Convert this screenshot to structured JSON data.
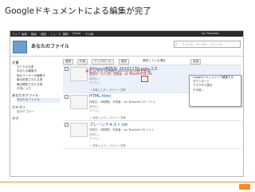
{
  "slide": {
    "title": "Googleドキュメントによる編集が完了"
  },
  "topbar": {
    "links": [
      "ウェブ",
      "画像",
      "動画",
      "地図",
      "ニュース",
      "翻訳",
      "Gmail",
      "その他"
    ],
    "user": "jun Terashita"
  },
  "header": {
    "title": "あなたのファイル",
    "search_placeholder": "ファイル、ユーザー、サイトの"
  },
  "sidebar": {
    "sections": [
      {
        "heading": "文書",
        "items": [
          "すべての文書",
          "あなたの編集中",
          "他のユーザーが編集中",
          "最近変更された文書",
          "最近閲覧された文書",
          "お気に入り"
        ]
      },
      {
        "heading": "あなたのファイル",
        "items": [
          "あなたのファイル"
        ]
      },
      {
        "heading": "カテゴリ",
        "items": [
          "全カテゴリー"
        ]
      },
      {
        "heading": "タグ",
        "items": []
      }
    ]
  },
  "toolbar": {
    "select": "選択",
    "create": "作成",
    "upload": "アップロード",
    "actions": "操作",
    "sort": "名前",
    "filter": "選択している項目"
  },
  "annotation": "チェックインされてバージョンが上がる",
  "files": [
    {
      "name": "Alfresco勉強会_20101130.pptx",
      "version": "2.0",
      "meta": "変更日：ちゃう作、変更者：jun Terashita   187 KB",
      "desc": "説明なし",
      "tags": "タグなし",
      "actions": "☆ お気に入り ▫ コメント 共有"
    },
    {
      "name": "HTML.html",
      "version": "",
      "meta": "作成日：3時間前、作成者：jun Terashita   127 バイト",
      "desc": "説明なし",
      "tags": "タグなし",
      "actions": "☆ お気に入り ▫ コメント 共有"
    },
    {
      "name": "プレーンテキスト.txt",
      "version": "",
      "meta": "作成日：3時間前、作成者：jun Terashita   63 バイト",
      "desc": "説明なし",
      "tags": "タグなし",
      "actions": "☆ お気に入り ▫ コメント 共有"
    }
  ],
  "popup": {
    "items": [
      "Googleドキュメントで編集する",
      "ダウンロード",
      "ブラウザで表示",
      "その他..."
    ]
  },
  "colors": {
    "accent_red": "#e0301e",
    "footer_orange": "#f28c28",
    "link_blue": "#1a4fa0"
  }
}
